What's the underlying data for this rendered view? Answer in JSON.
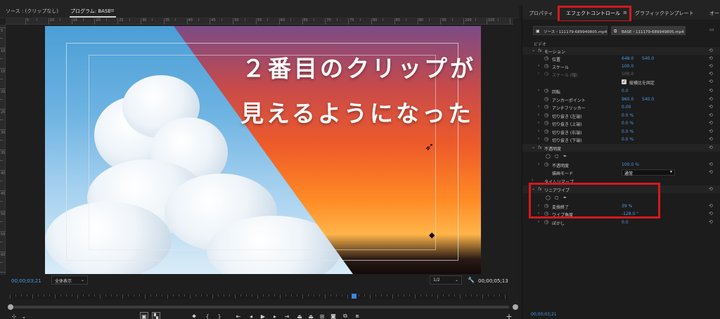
{
  "source_tab": "ソース : (クリップなし)",
  "program_tab": "プログラム: BASE",
  "program_menu_icon": "hamburger-icon",
  "ruler_numbers": [
    "5",
    "10",
    "15",
    "20",
    "25",
    "30",
    "35",
    "40",
    "45",
    "50",
    "55",
    "60",
    "65",
    "70",
    "75",
    "80",
    "85",
    "90",
    "95",
    "100",
    "105"
  ],
  "ruler_left_numbers": [
    "5",
    "10",
    "15",
    "20",
    "25",
    "30",
    "35",
    "40",
    "45",
    "50",
    "55",
    "60"
  ],
  "overlay": {
    "line1": "２番目のクリップが",
    "line2": "見えるようになった"
  },
  "controls": {
    "current_time": "00;00;03;21",
    "fit_select": "全体表示",
    "resolution_select": "1/2",
    "duration": "00;00;05;13"
  },
  "transport_icons": [
    "marker-icon",
    "in-point-icon",
    "out-point-icon",
    "go-to-in-icon",
    "step-back-icon",
    "play-icon",
    "step-forward-icon",
    "go-to-out-icon",
    "lift-icon",
    "extract-icon",
    "export-frame-icon",
    "compare-icon",
    "trim-icon"
  ],
  "ec": {
    "tabs": {
      "properties": "プロパティ",
      "effect_controls": "エフェクトコントロール",
      "graphic_template": "グラフィックテンプレート",
      "more": "オー"
    },
    "source_chip": "ソース・111179-689949805.mp4",
    "base_chip": "BASE・111179-689949805.mp4",
    "video_label": "ビデオ",
    "motion": "モーション",
    "position": {
      "label": "位置",
      "x": "648.0",
      "y": "540.0"
    },
    "scale": {
      "label": "スケール",
      "value": "100.0"
    },
    "scale_w": {
      "label": "スケール (幅)",
      "value": "100.0"
    },
    "uniform": "縦横比を固定",
    "rotation": {
      "label": "回転",
      "value": "0.0"
    },
    "anchor": {
      "label": "アンカーポイント",
      "x": "960.0",
      "y": "540.0"
    },
    "antiflicker": {
      "label": "アンチフリッカー",
      "value": "0.00"
    },
    "crop_left": {
      "label": "切り抜き (左端)",
      "value": "0.0 %"
    },
    "crop_top": {
      "label": "切り抜き (上端)",
      "value": "0.0 %"
    },
    "crop_right": {
      "label": "切り抜き (右端)",
      "value": "0.0 %"
    },
    "crop_bottom": {
      "label": "切り抜き (下端)",
      "value": "0.0 %"
    },
    "opacity_section": "不透明度",
    "opacity": {
      "label": "不透明度",
      "value": "100.0 %"
    },
    "blend": {
      "label": "描画モード",
      "value": "通常"
    },
    "time_remap": "タイムリマップ",
    "linear_wipe": "リニアワイプ",
    "transition_completion": {
      "label": "変換終了",
      "value": "39 %"
    },
    "wipe_angle": {
      "label": "ワイプ角度",
      "value": "-128.0 °"
    },
    "feather": {
      "label": "ぼかし",
      "value": "0.0"
    },
    "timecode": "00;00;03;21"
  },
  "colors": {
    "accent_blue": "#4a9be8",
    "highlight_red": "#d5191c"
  }
}
